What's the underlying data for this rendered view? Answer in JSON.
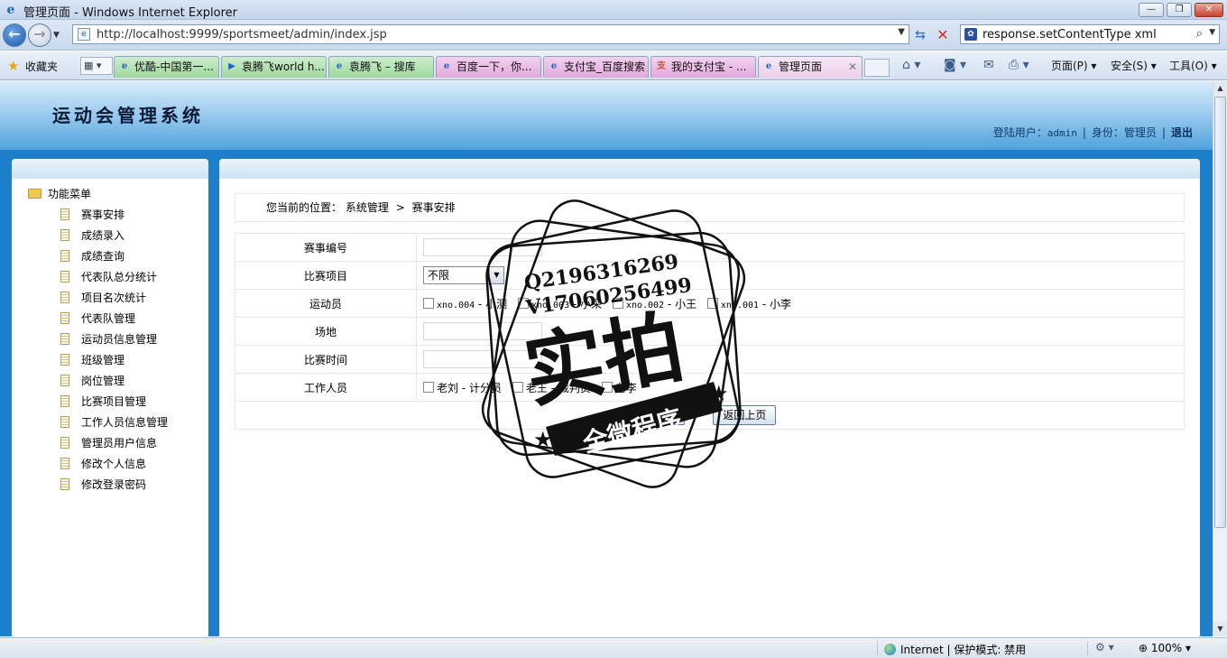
{
  "window": {
    "title": "管理页面 - Windows Internet Explorer",
    "min_glyph": "—",
    "max_glyph": "❐",
    "close_glyph": "✕"
  },
  "address_bar": {
    "url": "http://localhost:9999/sportsmeet/admin/index.jsp",
    "search_text": "response.setContentType xml",
    "back_glyph": "←",
    "forward_glyph": "→",
    "refresh_glyph": "⇆",
    "stop_glyph": "✕",
    "search_glyph": "⌕"
  },
  "favorites": {
    "label": "收藏夹",
    "tabs": [
      {
        "label": "优酷-中国第一...",
        "icon": "ie-page-icon"
      },
      {
        "label": "袁腾飞world h...",
        "icon": "video-icon"
      },
      {
        "label": "袁腾飞 – 搜库",
        "icon": "ie-page-icon"
      },
      {
        "label": "百度一下，你...",
        "icon": "ie-page-icon"
      },
      {
        "label": "支付宝_百度搜索",
        "icon": "ie-page-icon"
      },
      {
        "label": "我的支付宝 - ...",
        "icon": "alipay-icon"
      },
      {
        "label": "管理页面",
        "icon": "ie-page-icon",
        "active": true
      }
    ],
    "commands": {
      "page": "页面(P) ▾",
      "safety": "安全(S) ▾",
      "tools": "工具(O) ▾"
    }
  },
  "header": {
    "logo": "运动会管理系统",
    "login_label": "登陆用户：",
    "login_user": "admin",
    "role_label": "身份：",
    "role": "管理员",
    "logout": "退出"
  },
  "sidebar": {
    "root": "功能菜单",
    "items": [
      "赛事安排",
      "成绩录入",
      "成绩查询",
      "代表队总分统计",
      "项目名次统计",
      "代表队管理",
      "运动员信息管理",
      "班级管理",
      "岗位管理",
      "比赛项目管理",
      "工作人员信息管理",
      "管理员用户信息",
      "修改个人信息",
      "修改登录密码"
    ]
  },
  "breadcrumb": {
    "prefix": "您当前的位置：",
    "level1": "系统管理",
    "separator": ">",
    "level2": "赛事安排"
  },
  "form": {
    "match_no_label": "赛事编号",
    "match_no_value": "",
    "event_label": "比赛项目",
    "event_value": "不限",
    "athletes_label": "运动员",
    "athletes": [
      {
        "code": "xno.004",
        "name": "小测"
      },
      {
        "code": "xno.003",
        "name": "小采"
      },
      {
        "code": "xno.002",
        "name": "小王"
      },
      {
        "code": "xno.001",
        "name": "小李"
      }
    ],
    "venue_label": "场地",
    "venue_value": "",
    "time_label": "比赛时间",
    "time_value": "",
    "staff_label": "工作人员",
    "staff": [
      {
        "name": "老刘",
        "role": "计分员"
      },
      {
        "name": "老王",
        "role": "裁判员"
      },
      {
        "name": "老李",
        "role": ""
      }
    ],
    "submit_label": "提交",
    "back_label": "返回上页"
  },
  "status": {
    "zone": "Internet | 保护模式: 禁用",
    "zoom": "100%"
  },
  "watermark": {
    "line1": "Q2196316269",
    "line2": "V17060256499",
    "big": "实拍",
    "ribbon": "全微程序"
  }
}
